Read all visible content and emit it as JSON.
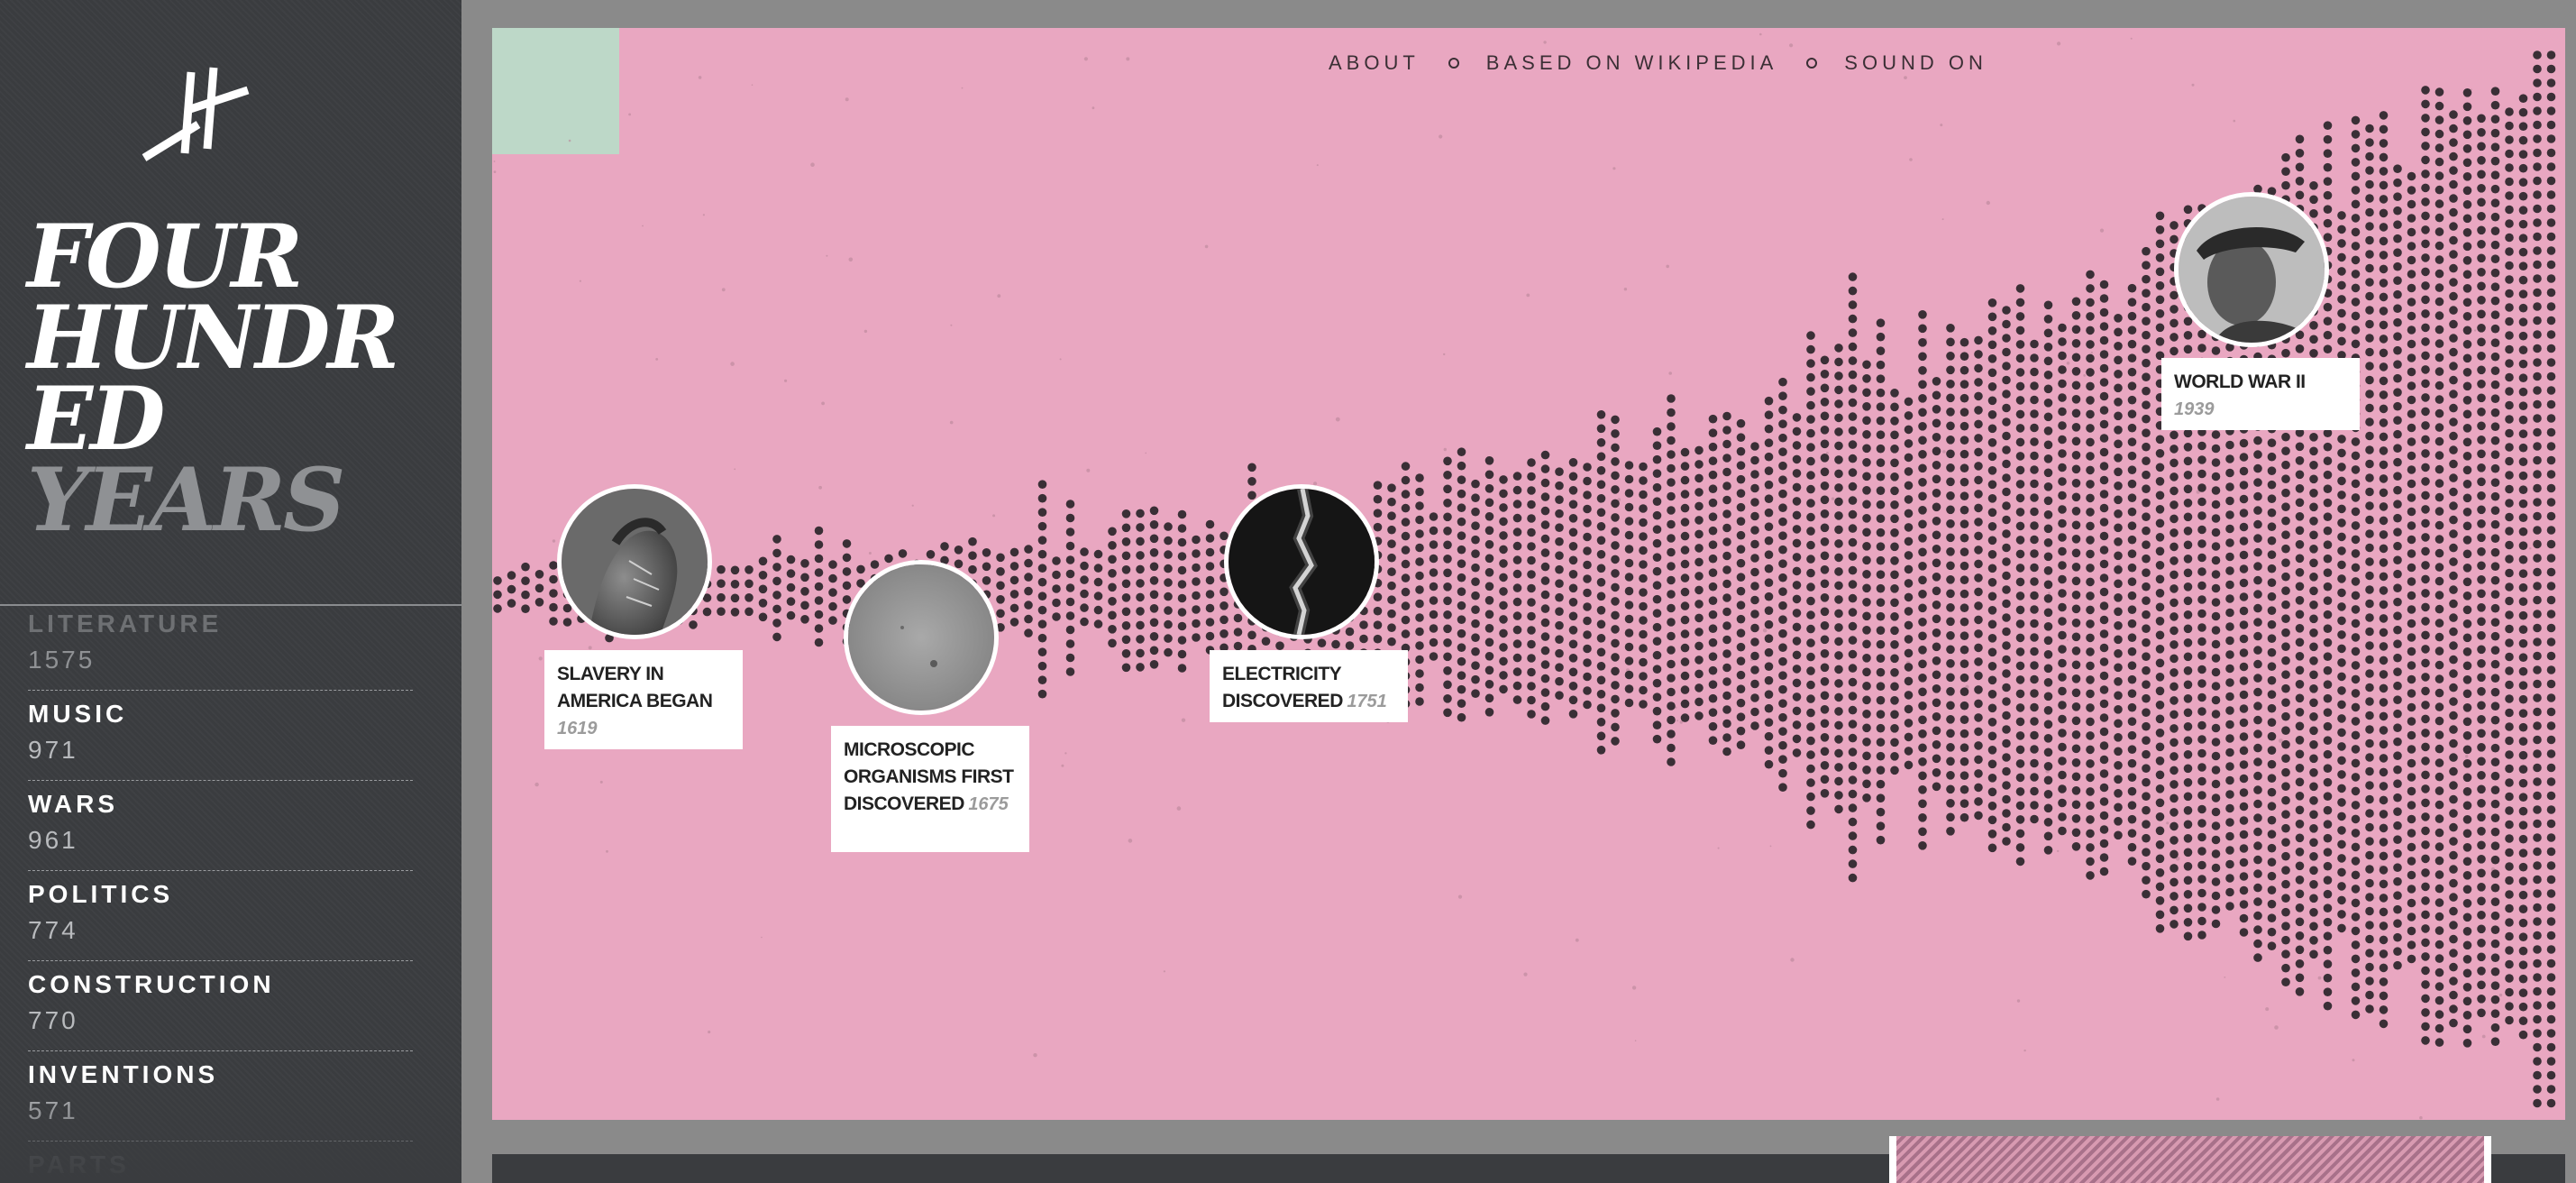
{
  "app": {
    "title_lines": [
      "FOUR",
      "HUNDR",
      "ED"
    ],
    "title_muted": "YEARS",
    "logo_icon": "four-hundred-years-logo-icon"
  },
  "categories": [
    {
      "name": "LITERATURE",
      "count": "1575"
    },
    {
      "name": "MUSIC",
      "count": "971"
    },
    {
      "name": "WARS",
      "count": "961"
    },
    {
      "name": "POLITICS",
      "count": "774"
    },
    {
      "name": "CONSTRUCTION",
      "count": "770"
    },
    {
      "name": "INVENTIONS",
      "count": "571"
    },
    {
      "name": "PARTS",
      "count": ""
    }
  ],
  "nav": {
    "about": "ABOUT",
    "based_on": "BASED ON WIKIPEDIA",
    "sound": "SOUND ON"
  },
  "events": [
    {
      "title_lines": [
        "SLAVERY IN",
        "AMERICA BEGAN"
      ],
      "year": "1619",
      "photo": "slavery-photo"
    },
    {
      "title_lines": [
        "MICROSCOPIC",
        "ORGANISMS FIRST",
        "DISCOVERED"
      ],
      "year": "1675",
      "photo": "microscope-photo"
    },
    {
      "title_lines": [
        "ELECTRICITY",
        "DISCOVERED"
      ],
      "year": "1751",
      "photo": "lightning-photo"
    },
    {
      "title_lines": [
        "WORLD WAR II"
      ],
      "year": "1939",
      "photo": "portrait-photo"
    }
  ],
  "colors": {
    "sidebar": "#3a3c3f",
    "panel": "#e9a7c1",
    "dots": "#3a2f36",
    "accent_block": "#bdd8c8"
  },
  "chart_data": {
    "type": "scatter",
    "description_of_encoding": "",
    "x_start_year": "",
    "series": []
  }
}
